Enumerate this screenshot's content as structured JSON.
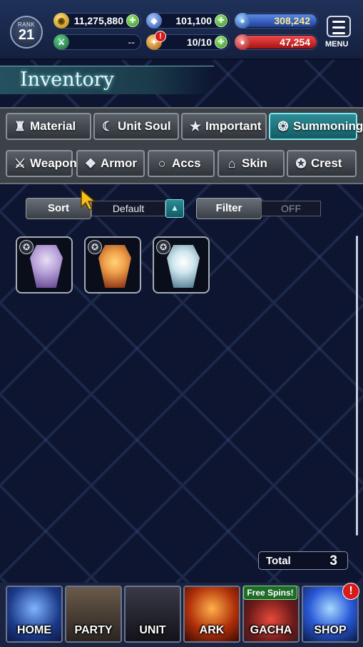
{
  "header": {
    "rank_label": "RANK",
    "rank_value": "21",
    "gil": "11,275,880",
    "lapis": "101,100",
    "blue_orb": "308,242",
    "bar_placeholder": "--",
    "stamina": "10/10",
    "red_orb": "47,254",
    "menu_label": "MENU",
    "alert": "!"
  },
  "page": {
    "title": "Inventory"
  },
  "tabs_row1": [
    "Material",
    "Unit Soul",
    "Important",
    "Summoning"
  ],
  "tabs_row2": [
    "Weapon",
    "Armor",
    "Accs",
    "Skin",
    "Crest"
  ],
  "active_tab": "Summoning",
  "controls": {
    "sort_label": "Sort",
    "sort_value": "Default",
    "filter_label": "Filter",
    "filter_value": "OFF"
  },
  "items": [
    {
      "name": "summon-crystal-purple",
      "color_a": "#b7a1d8",
      "color_b": "#5b3a8a"
    },
    {
      "name": "summon-crystal-fire",
      "color_a": "#f0a04a",
      "color_b": "#7a1e0a"
    },
    {
      "name": "summon-crystal-ice",
      "color_a": "#cfe6ee",
      "color_b": "#3e6c86"
    }
  ],
  "total": {
    "label": "Total",
    "value": "3"
  },
  "nav": {
    "home": "HOME",
    "party": "PARTY",
    "unit": "UNIT",
    "ark": "ARK",
    "gacha": "GACHA",
    "shop": "SHOP",
    "free_spins": "Free Spins!",
    "shop_alert": "!"
  },
  "colors": {
    "accent_active_tab": "#2e8e98",
    "background": "#0d1530"
  }
}
